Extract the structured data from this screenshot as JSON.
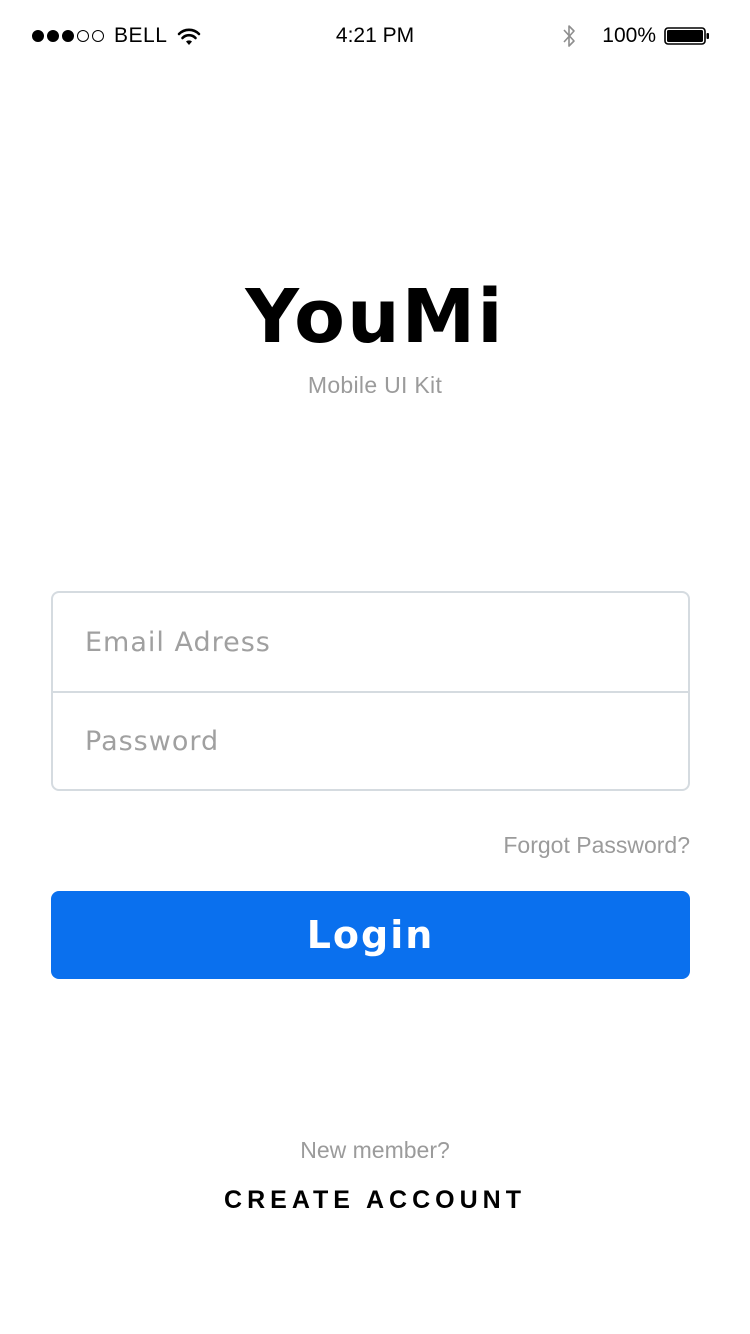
{
  "status_bar": {
    "carrier": "BELL",
    "time": "4:21 PM",
    "battery": "100%",
    "signal_strength": 3,
    "signal_max": 5,
    "icons": [
      "signal-icon",
      "wifi-icon",
      "bluetooth-icon",
      "battery-icon"
    ]
  },
  "brand": {
    "title": "YouMi",
    "subtitle": "Mobile UI Kit"
  },
  "form": {
    "email_placeholder": "Email Adress",
    "password_placeholder": "Password"
  },
  "links": {
    "forgot": "Forgot Password?"
  },
  "login_label": "Login",
  "footer": {
    "prompt": "New member?",
    "create_account": "CREATE ACCOUNT"
  },
  "colors": {
    "primary": "#0a70ee",
    "muted_text": "#9b9b9b",
    "border": "#d5dbe0"
  }
}
